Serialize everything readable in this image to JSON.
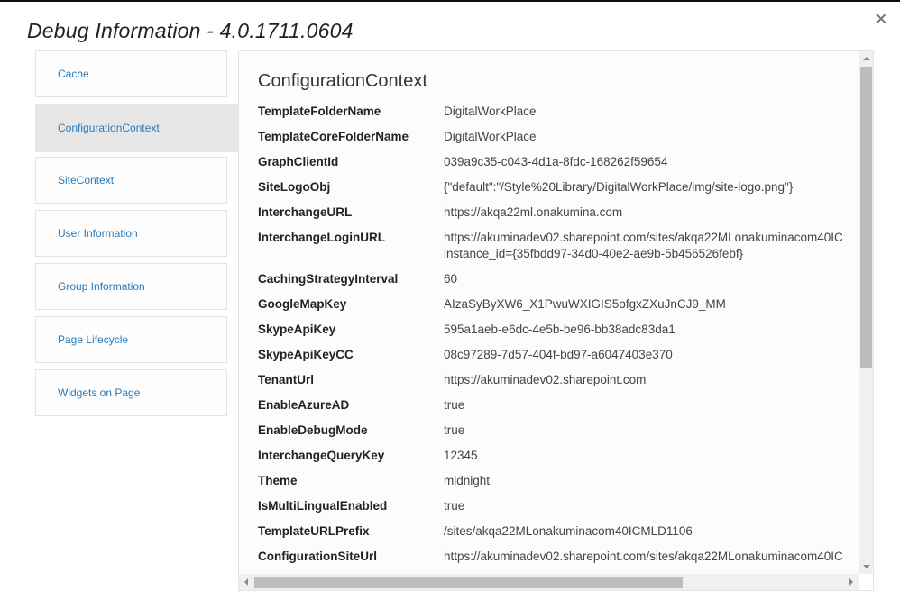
{
  "dialog": {
    "title": "Debug Information - 4.0.1711.0604",
    "close_icon": "close-icon"
  },
  "sidebar": {
    "items": [
      {
        "label": "Cache",
        "active": false
      },
      {
        "label": "ConfigurationContext",
        "active": true
      },
      {
        "label": "SiteContext",
        "active": false
      },
      {
        "label": "User Information",
        "active": false
      },
      {
        "label": "Group Information",
        "active": false
      },
      {
        "label": "Page Lifecycle",
        "active": false
      },
      {
        "label": "Widgets on Page",
        "active": false
      }
    ]
  },
  "panel": {
    "section_title": "ConfigurationContext",
    "rows": [
      {
        "key": "TemplateFolderName",
        "value": "DigitalWorkPlace"
      },
      {
        "key": "TemplateCoreFolderName",
        "value": "DigitalWorkPlace"
      },
      {
        "key": "GraphClientId",
        "value": "039a9c35-c043-4d1a-8fdc-168262f59654"
      },
      {
        "key": "SiteLogoObj",
        "value": "{\"default\":\"/Style%20Library/DigitalWorkPlace/img/site-logo.png\"}"
      },
      {
        "key": "InterchangeURL",
        "value": "https://akqa22ml.onakumina.com"
      },
      {
        "key": "InterchangeLoginURL",
        "value": "https://akuminadev02.sharepoint.com/sites/akqa22MLonakuminacom40IC",
        "value2": "instance_id={35fbdd97-34d0-40e2-ae9b-5b456526febf}"
      },
      {
        "key": "CachingStrategyInterval",
        "value": "60"
      },
      {
        "key": "GoogleMapKey",
        "value": "AIzaSyByXW6_X1PwuWXIGIS5ofgxZXuJnCJ9_MM"
      },
      {
        "key": "SkypeApiKey",
        "value": "595a1aeb-e6dc-4e5b-be96-bb38adc83da1"
      },
      {
        "key": "SkypeApiKeyCC",
        "value": "08c97289-7d57-404f-bd97-a6047403e370"
      },
      {
        "key": "TenantUrl",
        "value": "https://akuminadev02.sharepoint.com"
      },
      {
        "key": "EnableAzureAD",
        "value": "true"
      },
      {
        "key": "EnableDebugMode",
        "value": "true"
      },
      {
        "key": "InterchangeQueryKey",
        "value": "12345"
      },
      {
        "key": "Theme",
        "value": "midnight"
      },
      {
        "key": "IsMultiLingualEnabled",
        "value": "true"
      },
      {
        "key": "TemplateURLPrefix",
        "value": "/sites/akqa22MLonakuminacom40ICMLD1106"
      },
      {
        "key": "ConfigurationSiteUrl",
        "value": "https://akuminadev02.sharepoint.com/sites/akqa22MLonakuminacom40IC"
      }
    ]
  },
  "colors": {
    "link": "#2b7ab8",
    "active_nav_bg": "#e6e6e6",
    "scroll_thumb": "#bdbdbd"
  }
}
